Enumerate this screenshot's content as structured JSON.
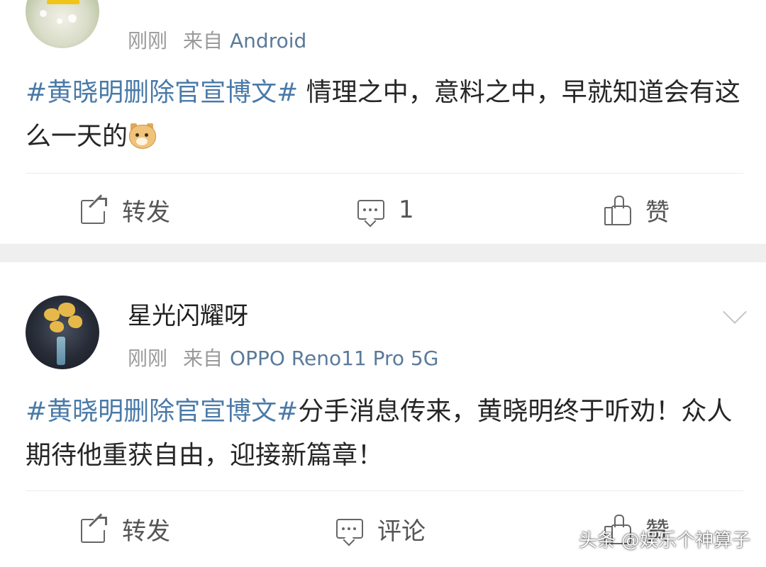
{
  "posts": [
    {
      "time": "刚刚",
      "source_prefix": "来自",
      "device": "Android",
      "topic": "#黄晓明删除官宣博文#",
      "text": " 情理之中，意料之中，早就知道会有这么一天的",
      "emoji": "doge-emoji",
      "actions": {
        "share": "转发",
        "comment": "1",
        "like": "赞"
      }
    },
    {
      "username": "星光闪耀呀",
      "time": "刚刚",
      "source_prefix": "来自",
      "device": "OPPO Reno11 Pro 5G",
      "topic": "#黄晓明删除官宣博文#",
      "text": "分手消息传来，黄晓明终于听劝！众人期待他重获自由，迎接新篇章！",
      "actions": {
        "share": "转发",
        "comment": "评论",
        "like": "赞"
      }
    }
  ],
  "watermark": "头条 @娱乐个神算子",
  "colors": {
    "link": "#4a7aa8",
    "device": "#5a7a9a",
    "meta": "#9a9a9a",
    "separator": "#efefef"
  }
}
